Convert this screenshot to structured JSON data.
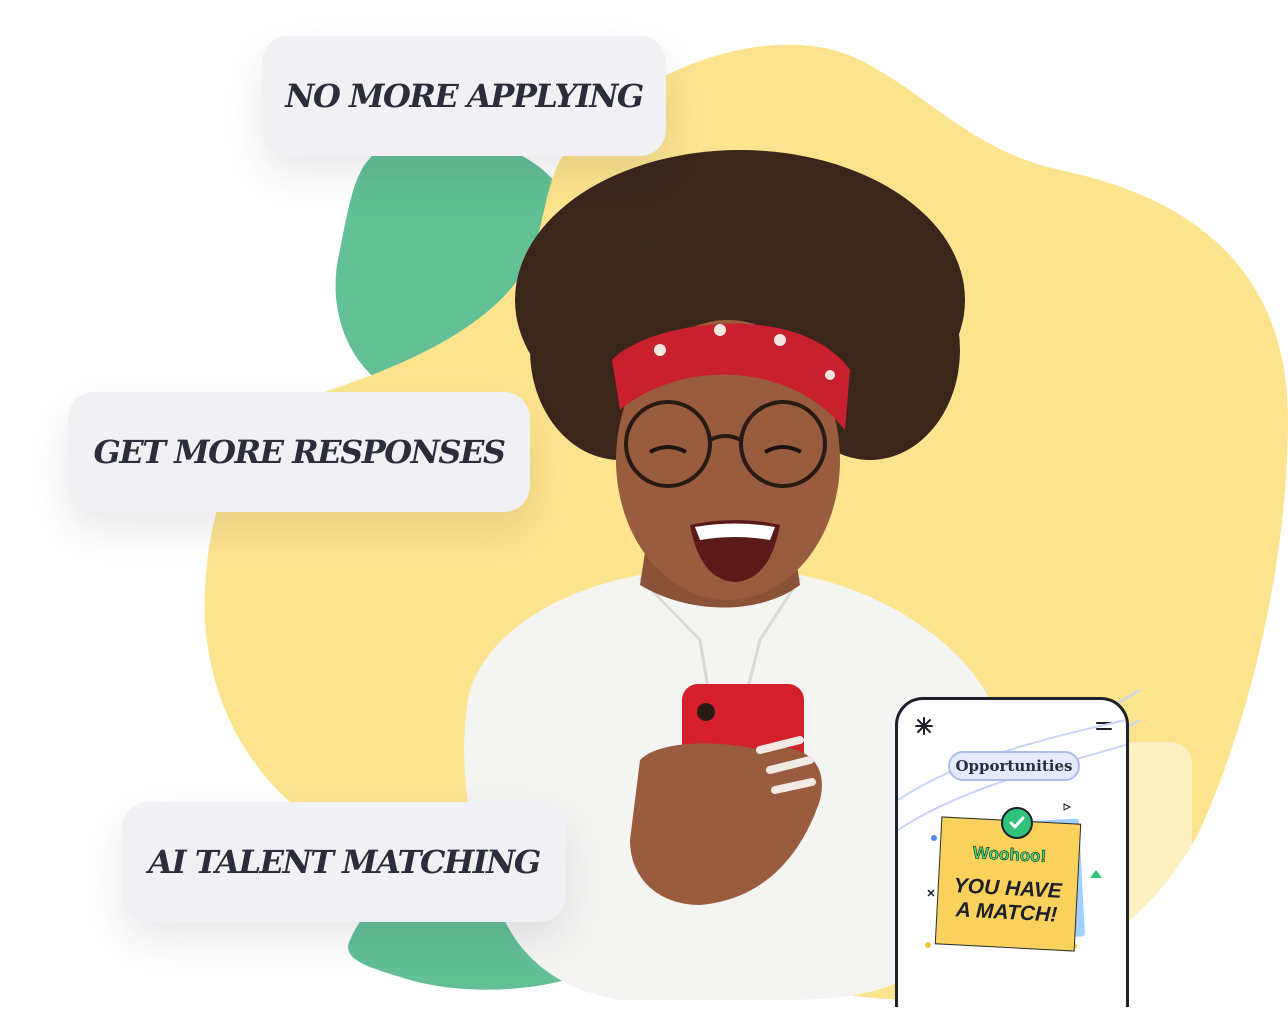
{
  "badges": {
    "no_more_applying": "NO MORE APPLYING",
    "get_more_responses": "GET MORE RESPONSES",
    "ai_talent_matching": "AI TALENT MATCHING"
  },
  "phone": {
    "tab_label": "Opportunities",
    "card_exclamation": "Woohoo!",
    "card_message": "YOU HAVE A MATCH!",
    "icons": [
      "logo-icon",
      "menu-icon",
      "checkmark-icon"
    ]
  },
  "colors": {
    "yellow_blob": "#fce38e",
    "green_blob": "#62bf96",
    "badge_bg": "#f1f1f5",
    "badge_text": "#2b2e3a",
    "card_yellow": "#fad25b",
    "check_green": "#2fc27b",
    "pill_blue": "#e4eaff"
  }
}
